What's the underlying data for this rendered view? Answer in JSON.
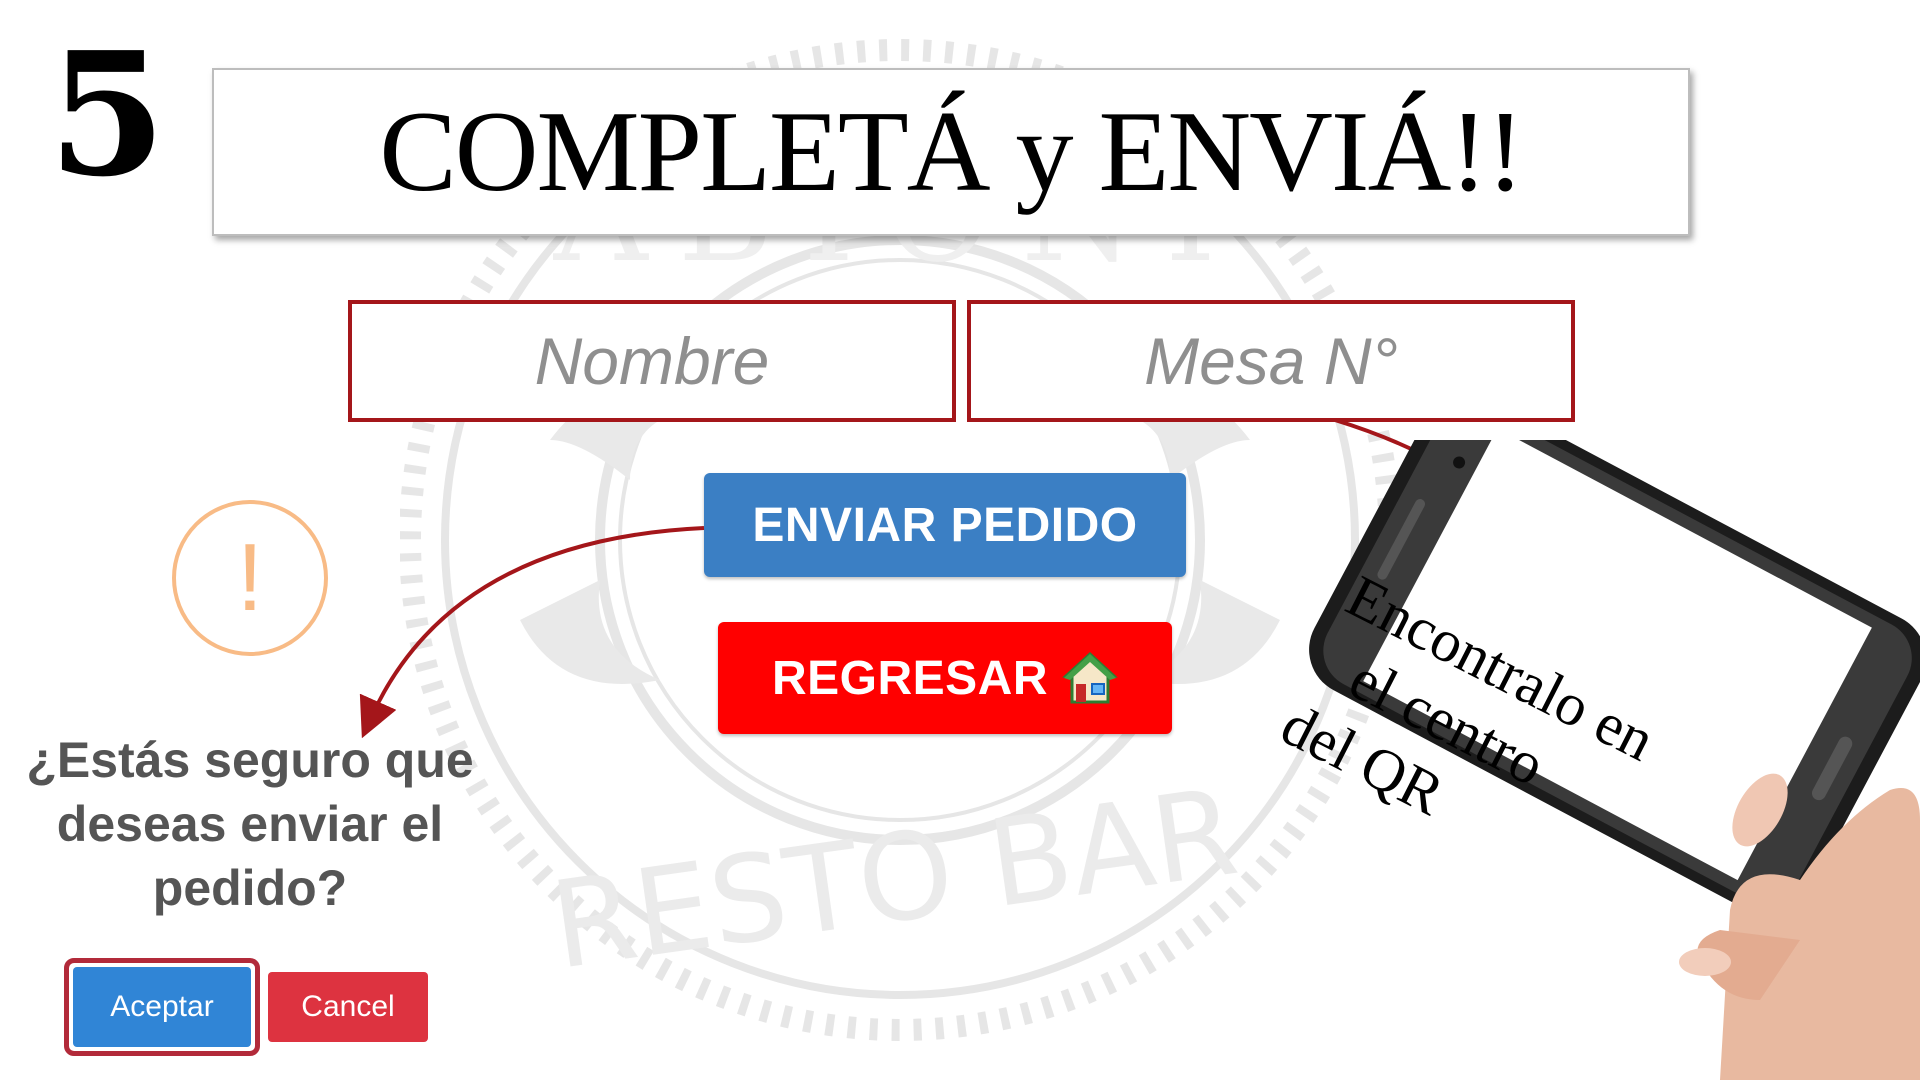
{
  "header": {
    "step_number": "5",
    "title": "COMPLETÁ y ENVIÁ!!"
  },
  "form": {
    "nombre_placeholder": "Nombre",
    "mesa_placeholder": "Mesa N°",
    "enviar_label": "ENVIAR PEDIDO",
    "regresar_label": "REGRESAR"
  },
  "alert": {
    "icon": "!",
    "message": "¿Estás seguro que deseas enviar el pedido?",
    "confirm_label": "Aceptar",
    "cancel_label": "Cancel"
  },
  "phone": {
    "line1": "Encontralo en",
    "line2": "el centro",
    "line3": "del QR"
  },
  "watermark": {
    "top_text": "ABIONI",
    "bottom_text": "RESTO BAR"
  },
  "colors": {
    "field_border": "#a4161a",
    "arrow": "#a4161a",
    "enviar": "#3b7fc4",
    "regresar": "#ff0000",
    "aceptar": "#3085d6",
    "cancel": "#dd3340",
    "warning": "#f8bb86"
  },
  "icons": {
    "warning": "warning-icon",
    "home": "home-icon",
    "phone": "smartphone-icon",
    "hand": "hand-icon"
  }
}
